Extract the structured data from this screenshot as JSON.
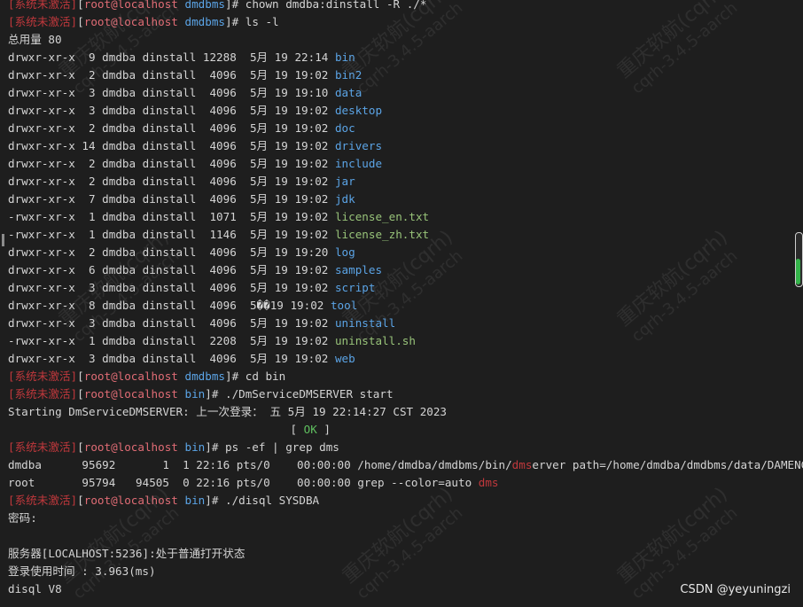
{
  "colors": {
    "background": "#1e1e1e",
    "text": "#d4d4d4",
    "prompt_status": "#c0383c",
    "prompt_user": "#e06c75",
    "directory": "#5ba4e6",
    "plain_file": "#98c379",
    "ok_status": "#5fbf5f",
    "scroll_thumb": "#34b34a"
  },
  "terminal": {
    "lines": [
      [
        {
          "t": "[系统未激活]",
          "c": "red"
        },
        {
          "t": "[",
          "c": "bracket"
        },
        {
          "t": "root@localhost",
          "c": "pink"
        },
        {
          "t": " ",
          "c": "default"
        },
        {
          "t": "dmdbms",
          "c": "dir"
        },
        {
          "t": "]# chown dmdba:dinstall -R ./*",
          "c": "default"
        }
      ],
      [
        {
          "t": "[系统未激活]",
          "c": "red"
        },
        {
          "t": "[",
          "c": "bracket"
        },
        {
          "t": "root@localhost",
          "c": "pink"
        },
        {
          "t": " ",
          "c": "default"
        },
        {
          "t": "dmdbms",
          "c": "dir"
        },
        {
          "t": "]# ls -l",
          "c": "default"
        }
      ],
      [
        {
          "t": "总用量 80",
          "c": "default"
        }
      ],
      [
        {
          "t": "drwxr-xr-x  9 dmdba dinstall 12288  5月 19 22:14 ",
          "c": "default"
        },
        {
          "t": "bin",
          "c": "dir"
        }
      ],
      [
        {
          "t": "drwxr-xr-x  2 dmdba dinstall  4096  5月 19 19:02 ",
          "c": "default"
        },
        {
          "t": "bin2",
          "c": "dir"
        }
      ],
      [
        {
          "t": "drwxr-xr-x  3 dmdba dinstall  4096  5月 19 19:10 ",
          "c": "default"
        },
        {
          "t": "data",
          "c": "dir"
        }
      ],
      [
        {
          "t": "drwxr-xr-x  3 dmdba dinstall  4096  5月 19 19:02 ",
          "c": "default"
        },
        {
          "t": "desktop",
          "c": "dir"
        }
      ],
      [
        {
          "t": "drwxr-xr-x  2 dmdba dinstall  4096  5月 19 19:02 ",
          "c": "default"
        },
        {
          "t": "doc",
          "c": "dir"
        }
      ],
      [
        {
          "t": "drwxr-xr-x 14 dmdba dinstall  4096  5月 19 19:02 ",
          "c": "default"
        },
        {
          "t": "drivers",
          "c": "dir"
        }
      ],
      [
        {
          "t": "drwxr-xr-x  2 dmdba dinstall  4096  5月 19 19:02 ",
          "c": "default"
        },
        {
          "t": "include",
          "c": "dir"
        }
      ],
      [
        {
          "t": "drwxr-xr-x  2 dmdba dinstall  4096  5月 19 19:02 ",
          "c": "default"
        },
        {
          "t": "jar",
          "c": "dir"
        }
      ],
      [
        {
          "t": "drwxr-xr-x  7 dmdba dinstall  4096  5月 19 19:02 ",
          "c": "default"
        },
        {
          "t": "jdk",
          "c": "dir"
        }
      ],
      [
        {
          "t": "-rwxr-xr-x  1 dmdba dinstall  1071  5月 19 19:02 ",
          "c": "default"
        },
        {
          "t": "license_en.txt",
          "c": "file"
        }
      ],
      [
        {
          "t": "-rwxr-xr-x  1 dmdba dinstall  1146  5月 19 19:02 ",
          "c": "default"
        },
        {
          "t": "license_zh.txt",
          "c": "file"
        }
      ],
      [
        {
          "t": "drwxr-xr-x  2 dmdba dinstall  4096  5月 19 19:20 ",
          "c": "default"
        },
        {
          "t": "log",
          "c": "dir"
        }
      ],
      [
        {
          "t": "drwxr-xr-x  6 dmdba dinstall  4096  5月 19 19:02 ",
          "c": "default"
        },
        {
          "t": "samples",
          "c": "dir"
        }
      ],
      [
        {
          "t": "drwxr-xr-x  3 dmdba dinstall  4096  5月 19 19:02 ",
          "c": "default"
        },
        {
          "t": "script",
          "c": "dir"
        }
      ],
      [
        {
          "t": "drwxr-xr-x  8 dmdba dinstall  4096  5��19 19:02 ",
          "c": "default"
        },
        {
          "t": "tool",
          "c": "dir"
        }
      ],
      [
        {
          "t": "drwxr-xr-x  3 dmdba dinstall  4096  5月 19 19:02 ",
          "c": "default"
        },
        {
          "t": "uninstall",
          "c": "dir"
        }
      ],
      [
        {
          "t": "-rwxr-xr-x  1 dmdba dinstall  2208  5月 19 19:02 ",
          "c": "default"
        },
        {
          "t": "uninstall.sh",
          "c": "file"
        }
      ],
      [
        {
          "t": "drwxr-xr-x  3 dmdba dinstall  4096  5月 19 19:02 ",
          "c": "default"
        },
        {
          "t": "web",
          "c": "dir"
        }
      ],
      [
        {
          "t": "[系统未激活]",
          "c": "red"
        },
        {
          "t": "[",
          "c": "bracket"
        },
        {
          "t": "root@localhost",
          "c": "pink"
        },
        {
          "t": " ",
          "c": "default"
        },
        {
          "t": "dmdbms",
          "c": "dir"
        },
        {
          "t": "]# cd bin",
          "c": "default"
        }
      ],
      [
        {
          "t": "[系统未激活]",
          "c": "red"
        },
        {
          "t": "[",
          "c": "bracket"
        },
        {
          "t": "root@localhost",
          "c": "pink"
        },
        {
          "t": " ",
          "c": "default"
        },
        {
          "t": "bin",
          "c": "dir"
        },
        {
          "t": "]# ./DmServiceDMSERVER start",
          "c": "default"
        }
      ],
      [
        {
          "t": "Starting DmServiceDMSERVER: 上一次登录： 五 5月 19 22:14:27 CST 2023",
          "c": "default"
        }
      ],
      [
        {
          "t": "                                          [ ",
          "c": "default"
        },
        {
          "t": "OK",
          "c": "green"
        },
        {
          "t": " ]",
          "c": "default"
        }
      ],
      [
        {
          "t": "[系统未激活]",
          "c": "red"
        },
        {
          "t": "[",
          "c": "bracket"
        },
        {
          "t": "root@localhost",
          "c": "pink"
        },
        {
          "t": " ",
          "c": "default"
        },
        {
          "t": "bin",
          "c": "dir"
        },
        {
          "t": "]# ps -ef | grep dms",
          "c": "default"
        }
      ],
      [
        {
          "t": "dmdba      95692       1  1 22:16 pts/0    00:00:00 /home/dmdba/dmdbms/bin/",
          "c": "default"
        },
        {
          "t": "dms",
          "c": "grepred"
        },
        {
          "t": "erver path=/home/dmdba/dmdbms/data/DAMENG/dm.ini -",
          "c": "default"
        }
      ],
      [
        {
          "t": "root       95794   94505  0 22:16 pts/0    00:00:00 grep --color=auto ",
          "c": "default"
        },
        {
          "t": "dms",
          "c": "grepred"
        }
      ],
      [
        {
          "t": "[系统未激活]",
          "c": "red"
        },
        {
          "t": "[",
          "c": "bracket"
        },
        {
          "t": "root@localhost",
          "c": "pink"
        },
        {
          "t": " ",
          "c": "default"
        },
        {
          "t": "bin",
          "c": "dir"
        },
        {
          "t": "]# ./disql SYSDBA",
          "c": "default"
        }
      ],
      [
        {
          "t": "密码:",
          "c": "default"
        }
      ],
      [
        {
          "t": "",
          "c": "default"
        }
      ],
      [
        {
          "t": "服务器[LOCALHOST:5236]:处于普通打开状态",
          "c": "default"
        }
      ],
      [
        {
          "t": "登录使用时间 : 3.963(ms)",
          "c": "default"
        }
      ],
      [
        {
          "t": "disql V8",
          "c": "default"
        }
      ]
    ]
  },
  "watermark": {
    "line1": "重庆软航(cqrh)",
    "line2": "cqrh-3.4.5-aarch"
  },
  "credit": "CSDN @yeyuningzi"
}
